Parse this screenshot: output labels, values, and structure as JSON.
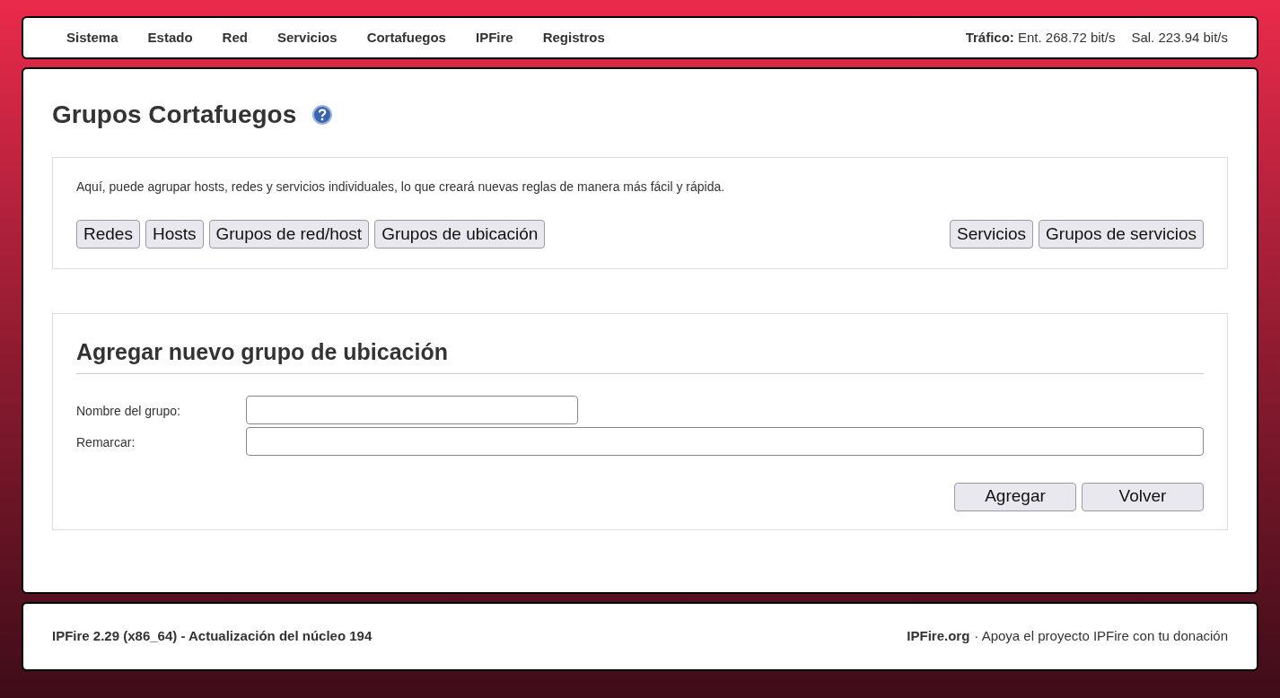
{
  "nav": {
    "items": [
      "Sistema",
      "Estado",
      "Red",
      "Servicios",
      "Cortafuegos",
      "IPFire",
      "Registros"
    ],
    "traffic": {
      "label": "Tráfico:",
      "incoming": "Ent. 268.72 bit/s",
      "outgoing": "Sal. 223.94 bit/s"
    }
  },
  "page": {
    "title": "Grupos Cortafuegos"
  },
  "intro": {
    "text": "Aquí, puede agrupar hosts, redes y servicios individuales, lo que creará nuevas reglas de manera más fácil y rápida.",
    "buttons_left": [
      "Redes",
      "Hosts",
      "Grupos de red/host",
      "Grupos de ubicación"
    ],
    "buttons_right": [
      "Servicios",
      "Grupos de servicios"
    ]
  },
  "form": {
    "title": "Agregar nuevo grupo de ubicación",
    "fields": [
      {
        "label": "Nombre del grupo:",
        "kind": "short"
      },
      {
        "label": "Remarcar:",
        "kind": "wide"
      }
    ],
    "actions": [
      "Agregar",
      "Volver"
    ]
  },
  "footer": {
    "version": "IPFire 2.29 (x86_64) - Actualización del núcleo 194",
    "link": "IPFire.org",
    "text": "· Apoya el proyecto IPFire con tu donación"
  }
}
